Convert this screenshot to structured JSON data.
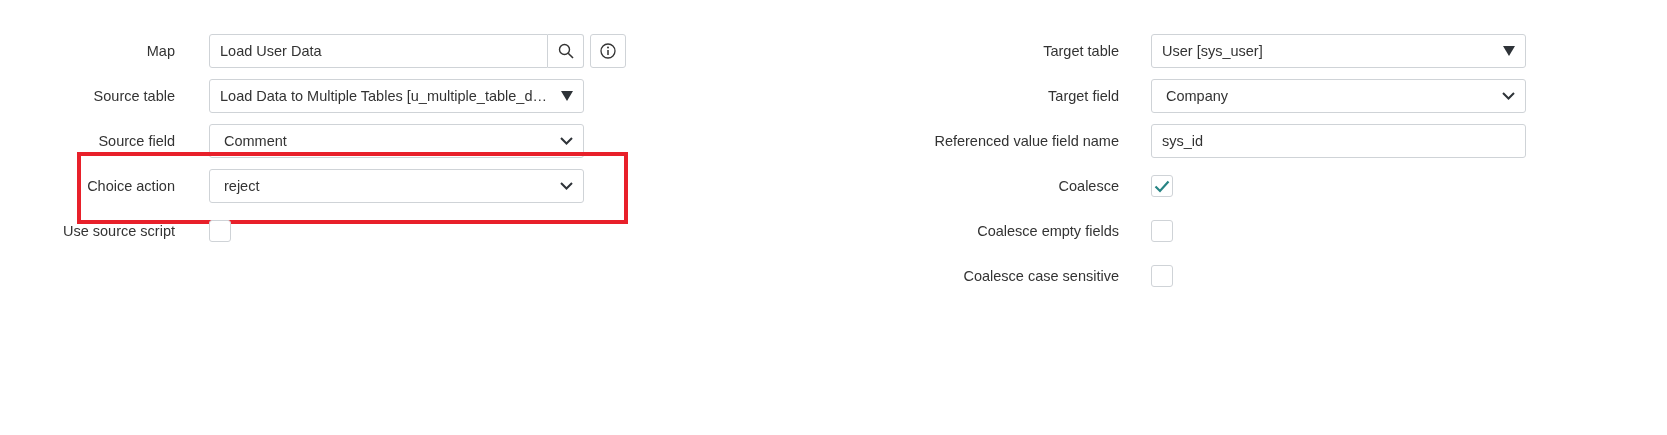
{
  "left_fields": [
    {
      "kind": "lookup",
      "label": "Map",
      "value": "Load User Data",
      "highlighted": false
    },
    {
      "kind": "reference",
      "label": "Source table",
      "value": "Load Data to Multiple Tables [u_multiple_table_d…",
      "highlighted": false
    },
    {
      "kind": "select",
      "label": "Source field",
      "value": "Comment",
      "highlighted": false
    },
    {
      "kind": "select",
      "label": "Choice action",
      "value": "reject",
      "highlighted": true
    },
    {
      "kind": "checkbox",
      "label": "Use source script",
      "checked": false,
      "highlighted": false
    }
  ],
  "right_fields": [
    {
      "kind": "reference",
      "label": "Target table",
      "value": "User [sys_user]",
      "highlighted": false
    },
    {
      "kind": "select",
      "label": "Target field",
      "value": "Company",
      "highlighted": false
    },
    {
      "kind": "text",
      "label": "Referenced value field name",
      "value": "sys_id",
      "highlighted": false
    },
    {
      "kind": "checkbox",
      "label": "Coalesce",
      "checked": true,
      "highlighted": false
    },
    {
      "kind": "checkbox",
      "label": "Coalesce empty fields",
      "checked": false,
      "highlighted": false
    },
    {
      "kind": "checkbox",
      "label": "Coalesce case sensitive",
      "checked": false,
      "highlighted": false
    }
  ]
}
